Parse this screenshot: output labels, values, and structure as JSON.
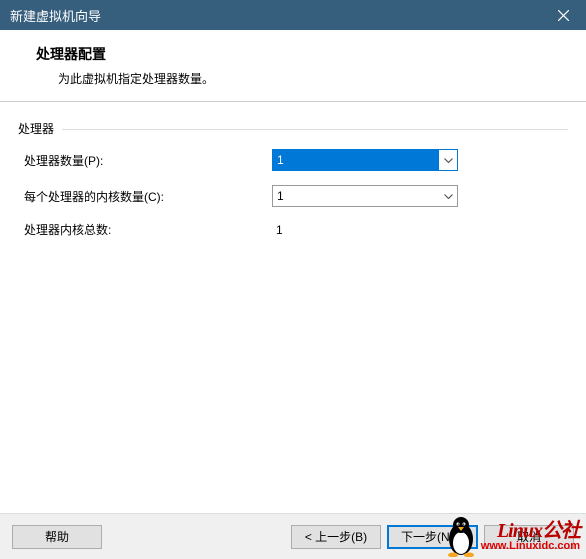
{
  "titlebar": {
    "title": "新建虚拟机向导"
  },
  "header": {
    "title": "处理器配置",
    "subtitle": "为此虚拟机指定处理器数量。"
  },
  "group": {
    "label": "处理器"
  },
  "fields": {
    "processors": {
      "label": "处理器数量(P):",
      "value": "1"
    },
    "cores": {
      "label": "每个处理器的内核数量(C):",
      "value": "1"
    },
    "total": {
      "label": "处理器内核总数:",
      "value": "1"
    }
  },
  "buttons": {
    "help": "帮助",
    "back": "< 上一步(B)",
    "next": "下一步(N) >",
    "cancel": "取消"
  },
  "watermark": {
    "line1": "Linux公社",
    "line2": "www.Linuxidc.com"
  }
}
